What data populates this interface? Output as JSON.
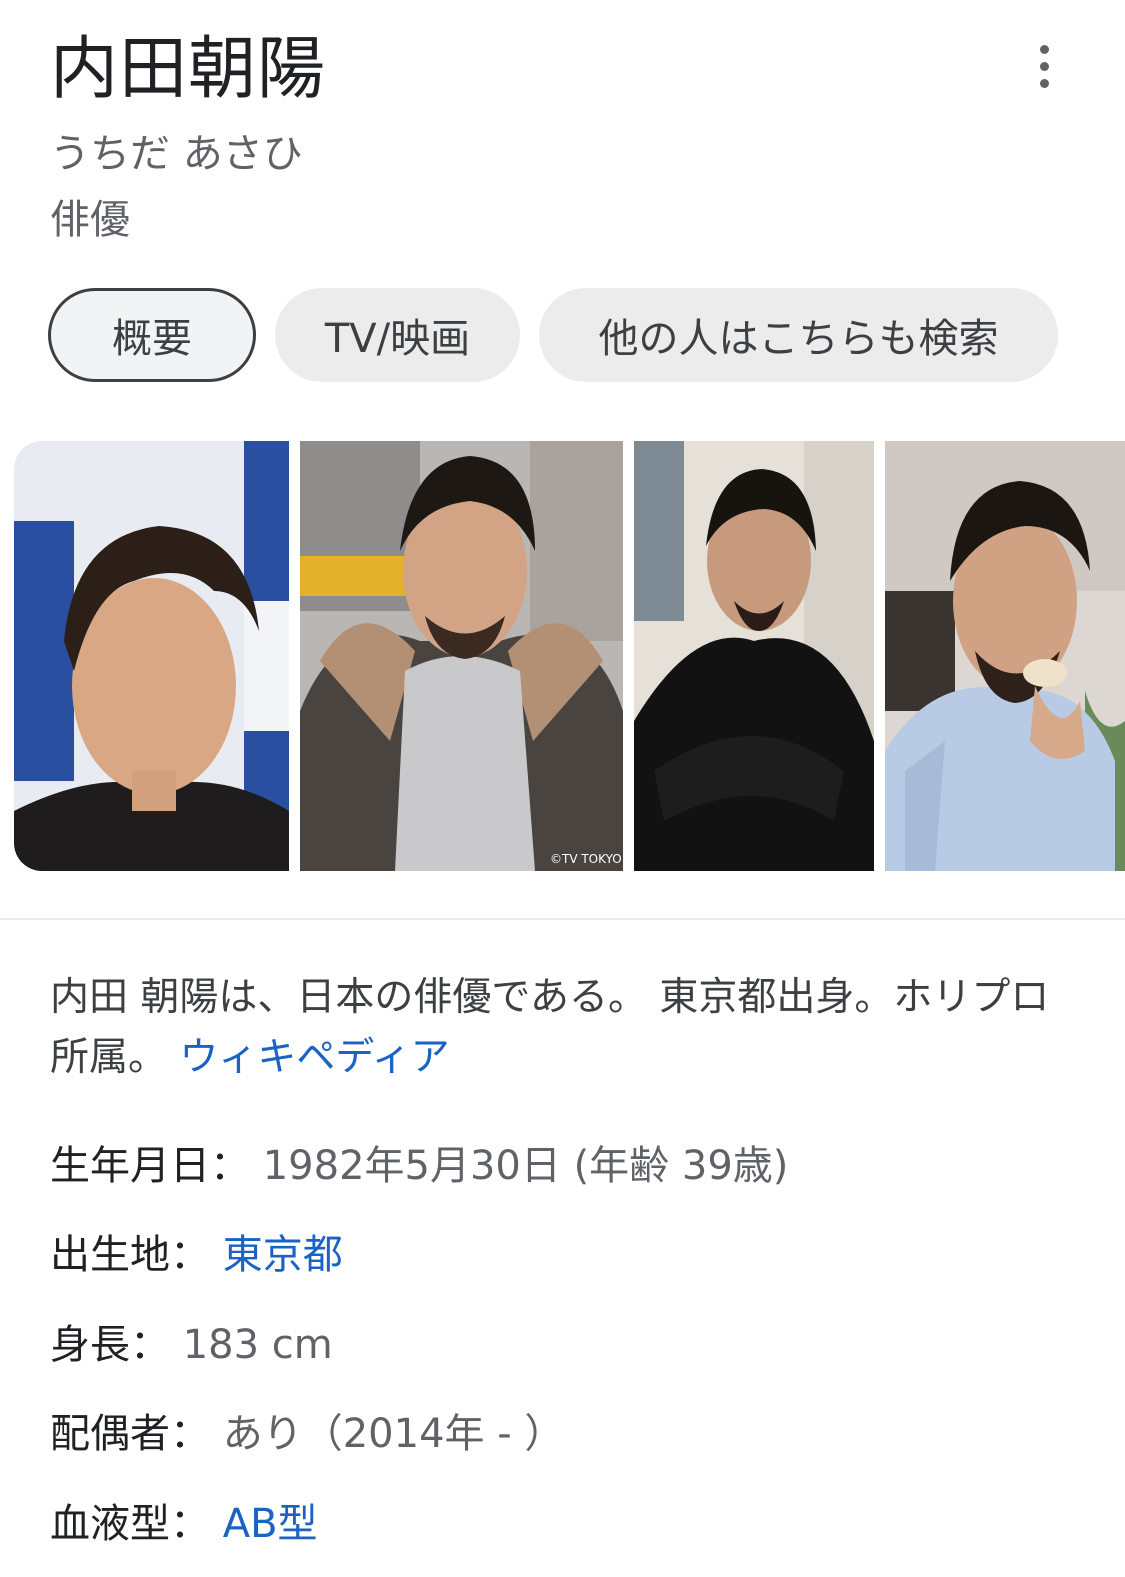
{
  "header": {
    "title": "内田朝陽",
    "kana": "うちだ あさひ",
    "occupation": "俳優"
  },
  "tabs": [
    {
      "label": "概要",
      "active": true
    },
    {
      "label": "TV/映画",
      "active": false
    },
    {
      "label": "他の人はこちらも検索",
      "active": false
    }
  ],
  "images": [
    {
      "icon": "person-photo"
    },
    {
      "icon": "person-photo",
      "watermark": "©TV TOKYO"
    },
    {
      "icon": "person-photo"
    },
    {
      "icon": "person-photo"
    }
  ],
  "description": {
    "text": "内田 朝陽は、日本の俳優である。 東京都出身。ホリプロ所属。 ",
    "source_link": "ウィキペディア"
  },
  "facts": [
    {
      "key": "生年月日",
      "sep": "： ",
      "value": "1982年5月30日 (年齢 39歳)",
      "is_link": false
    },
    {
      "key": "出生地",
      "sep": "： ",
      "value": "東京都",
      "is_link": true
    },
    {
      "key": "身長",
      "sep": "： ",
      "value": "183 cm",
      "is_link": false
    },
    {
      "key": "配偶者",
      "sep": "： ",
      "value": "あり（2014年 - ）",
      "is_link": false
    },
    {
      "key": "血液型",
      "sep": "： ",
      "value": "AB型",
      "is_link": true
    }
  ],
  "colors": {
    "link": "#1a62c4",
    "title": "#202124",
    "secondary": "#5f6368",
    "tab_bg": "#ececed"
  }
}
